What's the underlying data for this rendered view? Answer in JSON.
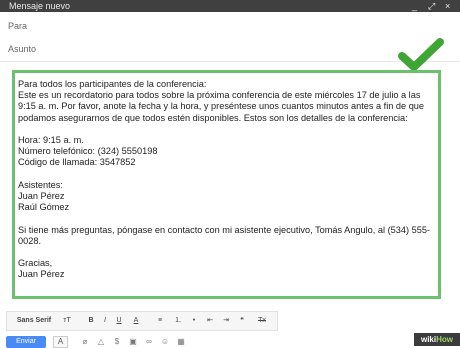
{
  "window": {
    "title": "Mensaje nuevo",
    "controls": [
      "_",
      "⤢",
      "×"
    ]
  },
  "fields": {
    "to_label": "Para",
    "subject_label": "Asunto"
  },
  "message": {
    "lines": [
      "Para todos los participantes de la conferencia:",
      "Este es un recordatorio para todos sobre la próxima conferencia de este miércoles 17 de julio a las 9:15 a. m. Por favor, anote la fecha y la hora, y preséntese unos cuantos minutos antes a fin de que podamos asegurarnos de que todos estén disponibles. Estos son los detalles de la conferencia:",
      "",
      "Hora: 9:15 a. m.",
      "Número telefónico: (324) 5550198",
      "Código de llamada: 3547852",
      "",
      "Asistentes:",
      "Juan Pérez",
      "Raúl Gómez",
      "",
      "Si tiene más preguntas, póngase en contacto con mi asistente ejecutivo, Tomás Angulo, al (534) 555-0028.",
      "",
      "Gracias,",
      "Juan Pérez"
    ]
  },
  "toolbar": {
    "font": "Sans Serif",
    "size_icon": "тT",
    "bold": "B",
    "italic": "I",
    "underline": "U",
    "text_color": "A",
    "align": "≡",
    "numbered": "⒈",
    "bulleted": "•",
    "indent_less": "⇤",
    "indent_more": "⇥",
    "quote": "❝",
    "clear": "Tx"
  },
  "bottom": {
    "send_label": "Enviar",
    "format_label": "A"
  },
  "watermark": {
    "wiki": "wiki",
    "how": "How"
  },
  "colors": {
    "highlight_border": "#6cc16e",
    "checkmark": "#3fa535",
    "send_button": "#4a8af4"
  }
}
